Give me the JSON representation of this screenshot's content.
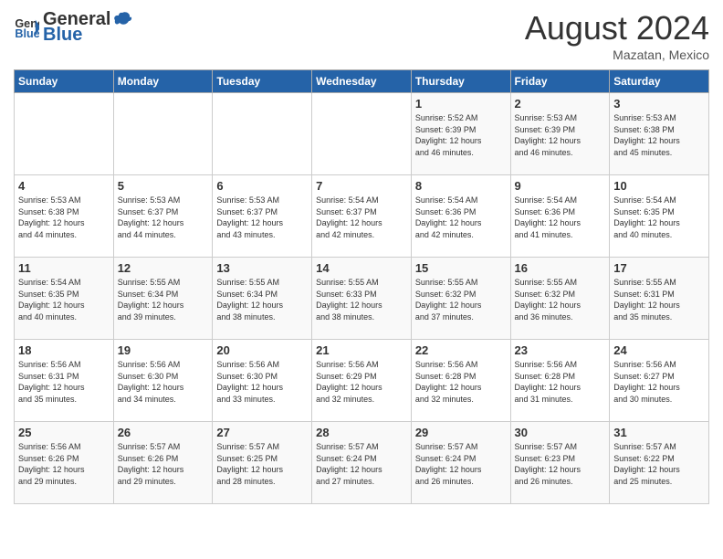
{
  "header": {
    "logo_general": "General",
    "logo_blue": "Blue",
    "month_year": "August 2024",
    "location": "Mazatan, Mexico"
  },
  "weekdays": [
    "Sunday",
    "Monday",
    "Tuesday",
    "Wednesday",
    "Thursday",
    "Friday",
    "Saturday"
  ],
  "weeks": [
    [
      {
        "day": "",
        "info": ""
      },
      {
        "day": "",
        "info": ""
      },
      {
        "day": "",
        "info": ""
      },
      {
        "day": "",
        "info": ""
      },
      {
        "day": "1",
        "info": "Sunrise: 5:52 AM\nSunset: 6:39 PM\nDaylight: 12 hours\nand 46 minutes."
      },
      {
        "day": "2",
        "info": "Sunrise: 5:53 AM\nSunset: 6:39 PM\nDaylight: 12 hours\nand 46 minutes."
      },
      {
        "day": "3",
        "info": "Sunrise: 5:53 AM\nSunset: 6:38 PM\nDaylight: 12 hours\nand 45 minutes."
      }
    ],
    [
      {
        "day": "4",
        "info": "Sunrise: 5:53 AM\nSunset: 6:38 PM\nDaylight: 12 hours\nand 44 minutes."
      },
      {
        "day": "5",
        "info": "Sunrise: 5:53 AM\nSunset: 6:37 PM\nDaylight: 12 hours\nand 44 minutes."
      },
      {
        "day": "6",
        "info": "Sunrise: 5:53 AM\nSunset: 6:37 PM\nDaylight: 12 hours\nand 43 minutes."
      },
      {
        "day": "7",
        "info": "Sunrise: 5:54 AM\nSunset: 6:37 PM\nDaylight: 12 hours\nand 42 minutes."
      },
      {
        "day": "8",
        "info": "Sunrise: 5:54 AM\nSunset: 6:36 PM\nDaylight: 12 hours\nand 42 minutes."
      },
      {
        "day": "9",
        "info": "Sunrise: 5:54 AM\nSunset: 6:36 PM\nDaylight: 12 hours\nand 41 minutes."
      },
      {
        "day": "10",
        "info": "Sunrise: 5:54 AM\nSunset: 6:35 PM\nDaylight: 12 hours\nand 40 minutes."
      }
    ],
    [
      {
        "day": "11",
        "info": "Sunrise: 5:54 AM\nSunset: 6:35 PM\nDaylight: 12 hours\nand 40 minutes."
      },
      {
        "day": "12",
        "info": "Sunrise: 5:55 AM\nSunset: 6:34 PM\nDaylight: 12 hours\nand 39 minutes."
      },
      {
        "day": "13",
        "info": "Sunrise: 5:55 AM\nSunset: 6:34 PM\nDaylight: 12 hours\nand 38 minutes."
      },
      {
        "day": "14",
        "info": "Sunrise: 5:55 AM\nSunset: 6:33 PM\nDaylight: 12 hours\nand 38 minutes."
      },
      {
        "day": "15",
        "info": "Sunrise: 5:55 AM\nSunset: 6:32 PM\nDaylight: 12 hours\nand 37 minutes."
      },
      {
        "day": "16",
        "info": "Sunrise: 5:55 AM\nSunset: 6:32 PM\nDaylight: 12 hours\nand 36 minutes."
      },
      {
        "day": "17",
        "info": "Sunrise: 5:55 AM\nSunset: 6:31 PM\nDaylight: 12 hours\nand 35 minutes."
      }
    ],
    [
      {
        "day": "18",
        "info": "Sunrise: 5:56 AM\nSunset: 6:31 PM\nDaylight: 12 hours\nand 35 minutes."
      },
      {
        "day": "19",
        "info": "Sunrise: 5:56 AM\nSunset: 6:30 PM\nDaylight: 12 hours\nand 34 minutes."
      },
      {
        "day": "20",
        "info": "Sunrise: 5:56 AM\nSunset: 6:30 PM\nDaylight: 12 hours\nand 33 minutes."
      },
      {
        "day": "21",
        "info": "Sunrise: 5:56 AM\nSunset: 6:29 PM\nDaylight: 12 hours\nand 32 minutes."
      },
      {
        "day": "22",
        "info": "Sunrise: 5:56 AM\nSunset: 6:28 PM\nDaylight: 12 hours\nand 32 minutes."
      },
      {
        "day": "23",
        "info": "Sunrise: 5:56 AM\nSunset: 6:28 PM\nDaylight: 12 hours\nand 31 minutes."
      },
      {
        "day": "24",
        "info": "Sunrise: 5:56 AM\nSunset: 6:27 PM\nDaylight: 12 hours\nand 30 minutes."
      }
    ],
    [
      {
        "day": "25",
        "info": "Sunrise: 5:56 AM\nSunset: 6:26 PM\nDaylight: 12 hours\nand 29 minutes."
      },
      {
        "day": "26",
        "info": "Sunrise: 5:57 AM\nSunset: 6:26 PM\nDaylight: 12 hours\nand 29 minutes."
      },
      {
        "day": "27",
        "info": "Sunrise: 5:57 AM\nSunset: 6:25 PM\nDaylight: 12 hours\nand 28 minutes."
      },
      {
        "day": "28",
        "info": "Sunrise: 5:57 AM\nSunset: 6:24 PM\nDaylight: 12 hours\nand 27 minutes."
      },
      {
        "day": "29",
        "info": "Sunrise: 5:57 AM\nSunset: 6:24 PM\nDaylight: 12 hours\nand 26 minutes."
      },
      {
        "day": "30",
        "info": "Sunrise: 5:57 AM\nSunset: 6:23 PM\nDaylight: 12 hours\nand 26 minutes."
      },
      {
        "day": "31",
        "info": "Sunrise: 5:57 AM\nSunset: 6:22 PM\nDaylight: 12 hours\nand 25 minutes."
      }
    ]
  ]
}
